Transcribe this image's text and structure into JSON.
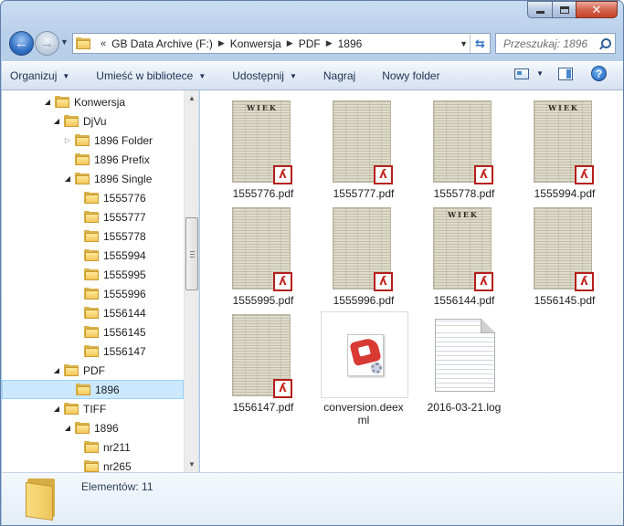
{
  "address": {
    "chevron": "«",
    "crumbs": [
      "GB Data Archive (F:)",
      "Konwersja",
      "PDF",
      "1896"
    ]
  },
  "search": {
    "placeholder": "Przeszukaj: 1896"
  },
  "commands": {
    "organize": "Organizuj",
    "library": "Umieść w bibliotece",
    "share": "Udostępnij",
    "burn": "Nagraj",
    "new_folder": "Nowy folder"
  },
  "tree": [
    {
      "label": "Konwersja",
      "indent": 0,
      "expander": "open"
    },
    {
      "label": "DjVu",
      "indent": 1,
      "expander": "open"
    },
    {
      "label": "1896 Folder",
      "indent": 2,
      "expander": "closed"
    },
    {
      "label": "1896 Prefix",
      "indent": 2,
      "expander": "none"
    },
    {
      "label": "1896 Single",
      "indent": 2,
      "expander": "open"
    },
    {
      "label": "1555776",
      "indent": 3,
      "expander": "none"
    },
    {
      "label": "1555777",
      "indent": 3,
      "expander": "none"
    },
    {
      "label": "1555778",
      "indent": 3,
      "expander": "none"
    },
    {
      "label": "1555994",
      "indent": 3,
      "expander": "none"
    },
    {
      "label": "1555995",
      "indent": 3,
      "expander": "none"
    },
    {
      "label": "1555996",
      "indent": 3,
      "expander": "none"
    },
    {
      "label": "1556144",
      "indent": 3,
      "expander": "none"
    },
    {
      "label": "1556145",
      "indent": 3,
      "expander": "none"
    },
    {
      "label": "1556147",
      "indent": 3,
      "expander": "none"
    },
    {
      "label": "PDF",
      "indent": 1,
      "expander": "open"
    },
    {
      "label": "1896",
      "indent": 2,
      "expander": "none",
      "selected": true
    },
    {
      "label": "TIFF",
      "indent": 1,
      "expander": "open"
    },
    {
      "label": "1896",
      "indent": 2,
      "expander": "open"
    },
    {
      "label": "nr211",
      "indent": 3,
      "expander": "none"
    },
    {
      "label": "nr265",
      "indent": 3,
      "expander": "none"
    }
  ],
  "files": [
    {
      "name": "1555776.pdf",
      "kind": "pdf",
      "masthead": "WIEK"
    },
    {
      "name": "1555777.pdf",
      "kind": "pdf",
      "masthead": ""
    },
    {
      "name": "1555778.pdf",
      "kind": "pdf",
      "masthead": ""
    },
    {
      "name": "1555994.pdf",
      "kind": "pdf",
      "masthead": "WIEK"
    },
    {
      "name": "1555995.pdf",
      "kind": "pdf",
      "masthead": ""
    },
    {
      "name": "1555996.pdf",
      "kind": "pdf",
      "masthead": ""
    },
    {
      "name": "1556144.pdf",
      "kind": "pdf",
      "masthead": "WIEK"
    },
    {
      "name": "1556145.pdf",
      "kind": "pdf",
      "masthead": ""
    },
    {
      "name": "1556147.pdf",
      "kind": "pdf",
      "masthead": ""
    },
    {
      "name": "conversion.deexml",
      "kind": "deex",
      "masthead": ""
    },
    {
      "name": "2016-03-21.log",
      "kind": "log",
      "masthead": ""
    }
  ],
  "details": {
    "count": "Elementów: 11"
  },
  "icons": {
    "back": "back-arrow-icon",
    "forward": "forward-arrow-icon",
    "folder": "folder-icon",
    "pdf": "pdf-file-icon",
    "search": "search-icon",
    "help": "help-icon"
  },
  "colors": {
    "selection": "#cce8ff",
    "pdf_badge": "#b41f1b",
    "folder": "#f3c75a"
  }
}
